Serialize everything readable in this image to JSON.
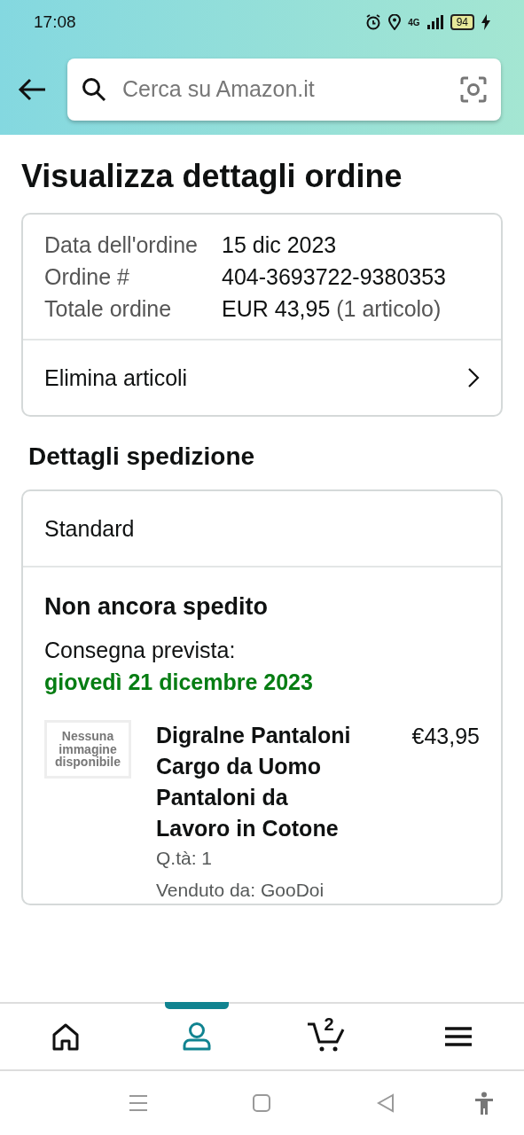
{
  "status_bar": {
    "time": "17:08",
    "network": "4G",
    "battery": "94"
  },
  "header": {
    "search": {
      "placeholder": "Cerca su Amazon.it"
    }
  },
  "title": "Visualizza dettagli ordine",
  "order_summary": {
    "rows": [
      {
        "label": "Data dell'ordine",
        "value": "15 dic 2023"
      },
      {
        "label": "Ordine #",
        "value": "404-3693722-9380353"
      },
      {
        "label": "Totale ordine",
        "value": "EUR 43,95",
        "note": "(1 articolo)"
      }
    ],
    "action": "Elimina articoli"
  },
  "shipping": {
    "heading": "Dettagli spedizione",
    "method": "Standard",
    "status": "Non ancora spedito",
    "delivery_label": "Consegna prevista:",
    "delivery_date": "giovedì 21 dicembre 2023",
    "item": {
      "placeholder_image": "Nessuna immagine disponibile",
      "title": "Digralne Pantaloni Cargo da Uomo Pantaloni da Lavoro in Cotone",
      "price": "€43,95",
      "quantity": "Q.tà: 1",
      "seller": "Venduto da: GooDoi"
    }
  },
  "bottom_nav": [
    {
      "kind": "home",
      "selected": false
    },
    {
      "kind": "account",
      "selected": true
    },
    {
      "kind": "cart",
      "selected": false,
      "count": "2"
    },
    {
      "kind": "menu",
      "selected": false
    }
  ]
}
